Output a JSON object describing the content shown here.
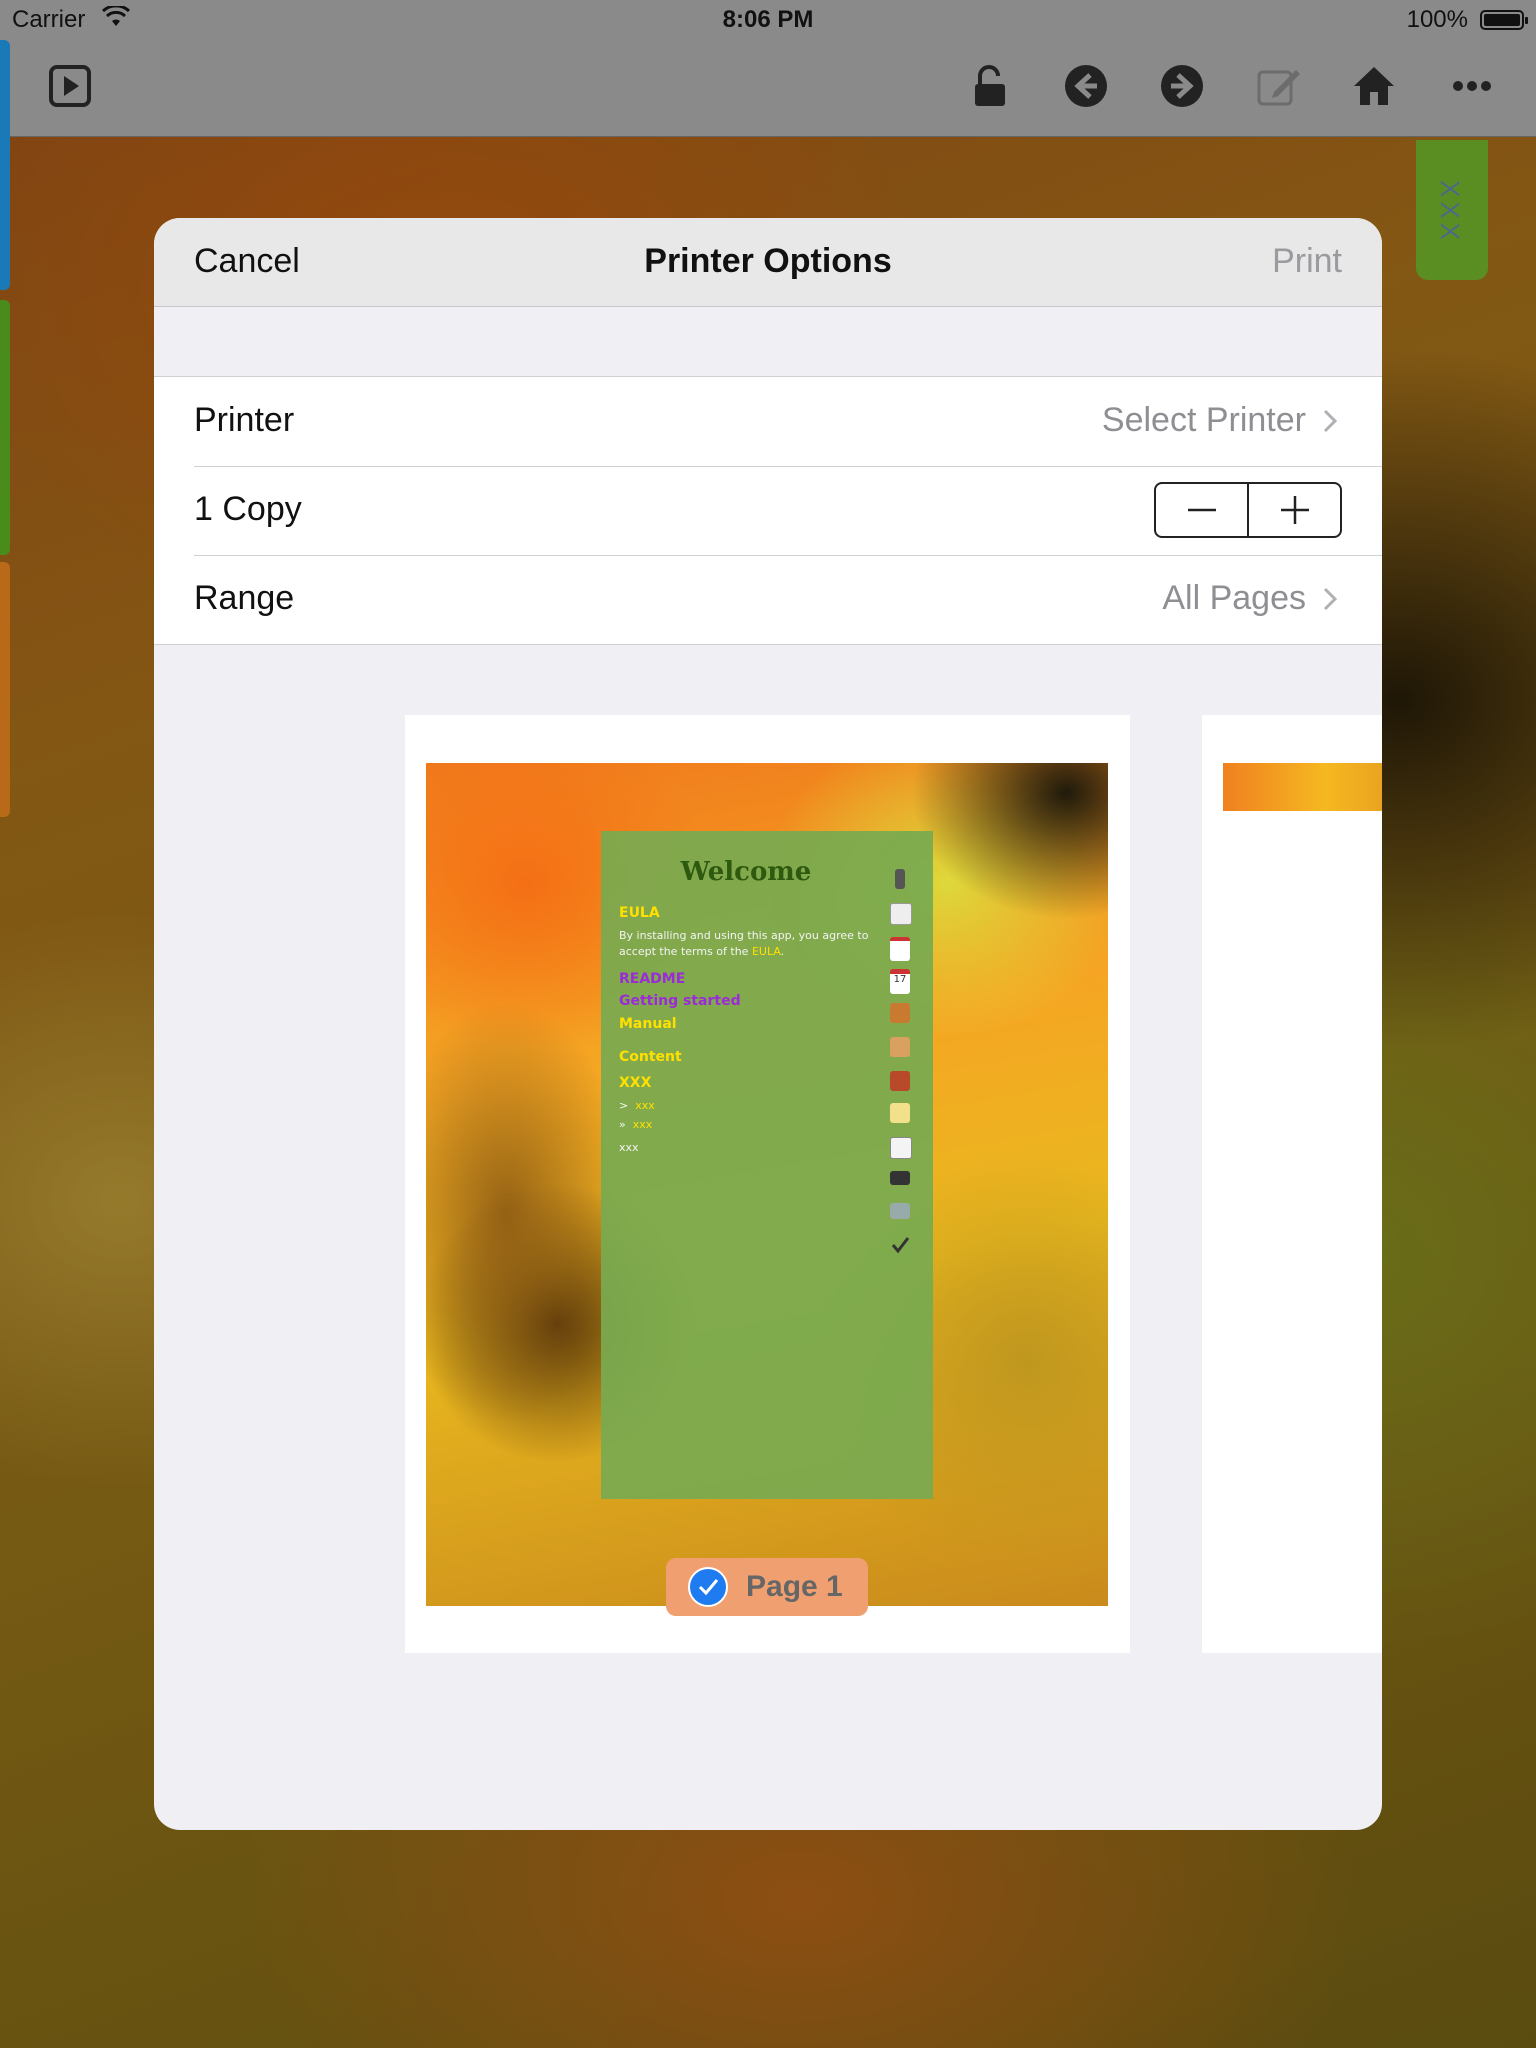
{
  "status_bar": {
    "carrier": "Carrier",
    "time": "8:06 PM",
    "battery": "100%"
  },
  "side_tab": {
    "label": "XXX"
  },
  "dialog": {
    "cancel_label": "Cancel",
    "title": "Printer Options",
    "print_label": "Print",
    "rows": {
      "printer": {
        "label": "Printer",
        "value": "Select Printer"
      },
      "copies": {
        "label": "1 Copy"
      },
      "range": {
        "label": "Range",
        "value": "All Pages"
      }
    },
    "preview": {
      "page_label": "Page 1",
      "page_selected": true,
      "content": {
        "heading": "Welcome",
        "eula_title": "EULA",
        "eula_text_1": "By installing and using this app, you agree to",
        "eula_text_2": "accept the terms of the",
        "eula_link": "EULA",
        "eula_period": ".",
        "readme": "README",
        "getting_started": "Getting started",
        "manual": "Manual",
        "content_title": "Content",
        "xxx_title": "XXX",
        "sub_1_marker": ">",
        "sub_1": "xxx",
        "sub_2_marker": "»",
        "sub_2": "xxx",
        "plain": "xxx",
        "calendar_day": "17"
      }
    }
  },
  "colors": {
    "accent": "#1e7cf0",
    "toolbar": "#8a8a8a",
    "dialog_bg": "#efeff4",
    "green_card": "#78aa50",
    "link_yellow": "#ffe000",
    "link_purple": "#9b2bd8"
  }
}
